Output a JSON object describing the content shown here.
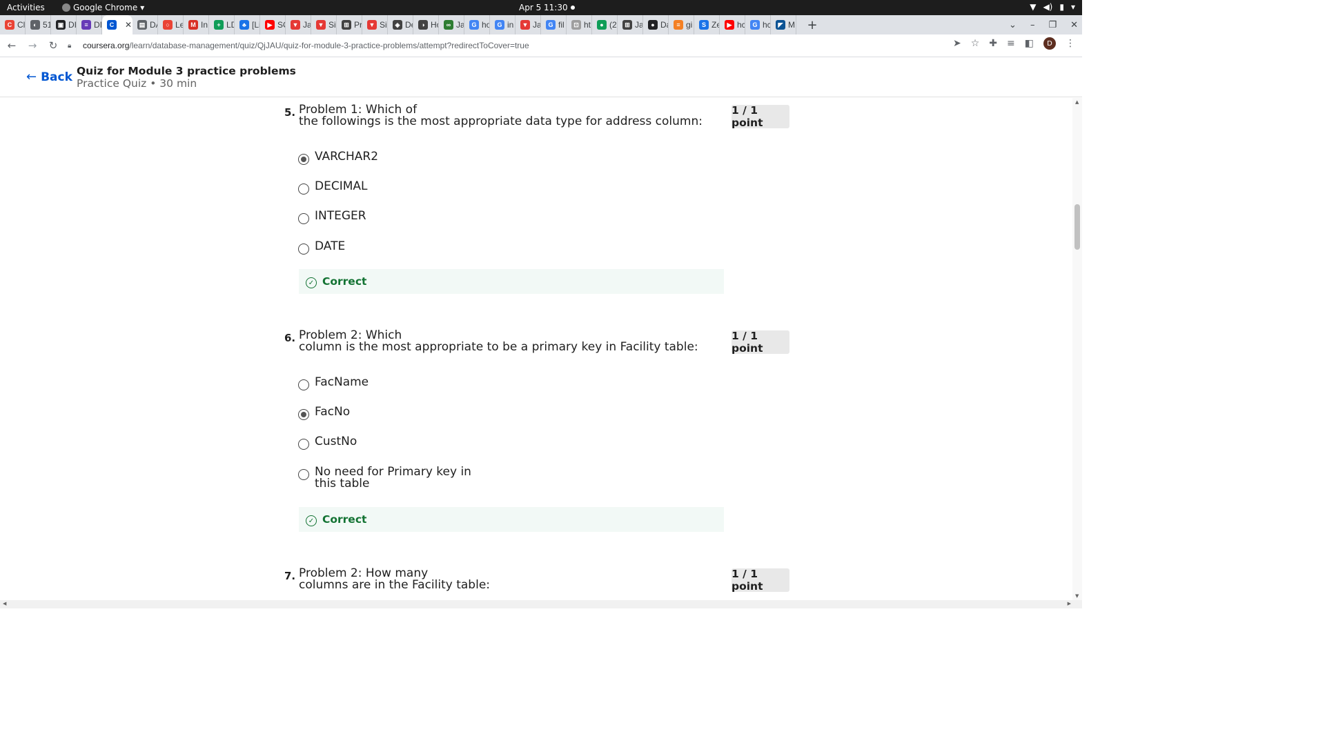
{
  "system": {
    "activities": "Activities",
    "app_name": "Google Chrome",
    "clock": "Apr 5  11:30"
  },
  "tabs": [
    {
      "label": "Cl",
      "color": "#ea4335",
      "glyph": "C"
    },
    {
      "label": "51",
      "color": "#5f6368",
      "glyph": "◐"
    },
    {
      "label": "DI",
      "color": "#202124",
      "glyph": "▣"
    },
    {
      "label": "DI",
      "color": "#673ab7",
      "glyph": "≡"
    },
    {
      "label": "",
      "color": "#0056d2",
      "glyph": "C",
      "active": true
    },
    {
      "label": "DA",
      "color": "#5f6368",
      "glyph": "▤"
    },
    {
      "label": "Le",
      "color": "#ea4335",
      "glyph": "○"
    },
    {
      "label": "In",
      "color": "#d93025",
      "glyph": "M"
    },
    {
      "label": "LD",
      "color": "#0f9d58",
      "glyph": "+"
    },
    {
      "label": "[Li",
      "color": "#1a73e8",
      "glyph": "♣"
    },
    {
      "label": "SC",
      "color": "#ff0000",
      "glyph": "▶"
    },
    {
      "label": "Ja",
      "color": "#e53935",
      "glyph": "▼"
    },
    {
      "label": "Si",
      "color": "#e53935",
      "glyph": "▼"
    },
    {
      "label": "Pr",
      "color": "#424242",
      "glyph": "⊞"
    },
    {
      "label": "Si",
      "color": "#e53935",
      "glyph": "▼"
    },
    {
      "label": "De",
      "color": "#424242",
      "glyph": "◈"
    },
    {
      "label": "Ho",
      "color": "#424242",
      "glyph": "◑"
    },
    {
      "label": "Ja",
      "color": "#2e7d32",
      "glyph": "∞"
    },
    {
      "label": "ho",
      "color": "#4285f4",
      "glyph": "G"
    },
    {
      "label": "in",
      "color": "#4285f4",
      "glyph": "G"
    },
    {
      "label": "Ja",
      "color": "#e53935",
      "glyph": "▼"
    },
    {
      "label": "fil",
      "color": "#4285f4",
      "glyph": "G"
    },
    {
      "label": "ht",
      "color": "#9e9e9e",
      "glyph": "⊡"
    },
    {
      "label": "(2",
      "color": "#0f9d58",
      "glyph": "●"
    },
    {
      "label": "Ja",
      "color": "#424242",
      "glyph": "⊞"
    },
    {
      "label": "Da",
      "color": "#202124",
      "glyph": "●"
    },
    {
      "label": "gi",
      "color": "#f48024",
      "glyph": "≡"
    },
    {
      "label": "Ze",
      "color": "#1a73e8",
      "glyph": "S"
    },
    {
      "label": "hc",
      "color": "#ff0000",
      "glyph": "▶"
    },
    {
      "label": "hc",
      "color": "#4285f4",
      "glyph": "G"
    },
    {
      "label": "M",
      "color": "#0b5394",
      "glyph": "◤"
    }
  ],
  "address": {
    "domain": "coursera.org",
    "path": "/learn/database-management/quiz/QjJAU/quiz-for-module-3-practice-problems/attempt?redirectToCover=true"
  },
  "avatar_initial": "D",
  "header": {
    "back_label": "Back",
    "title": "Quiz for Module 3 practice problems",
    "subtitle": "Practice Quiz • 30 min"
  },
  "questions": [
    {
      "number": "5.",
      "line1": "Problem 1: Which of",
      "line2": "the followings is the most appropriate data type for address column:",
      "points": "1 / 1 point",
      "options": [
        {
          "label": "VARCHAR2",
          "checked": true
        },
        {
          "label": "DECIMAL",
          "checked": false
        },
        {
          "label": "INTEGER",
          "checked": false
        },
        {
          "label": "DATE",
          "checked": false
        }
      ],
      "feedback": "Correct"
    },
    {
      "number": "6.",
      "line1": "Problem 2: Which",
      "line2": "column is the most appropriate to be a primary key in Facility table:",
      "points": "1 / 1 point",
      "options": [
        {
          "label": "FacName",
          "checked": false
        },
        {
          "label": "FacNo",
          "checked": true
        },
        {
          "label": "CustNo",
          "checked": false
        },
        {
          "label": "No need for Primary key in",
          "label2": "this table",
          "checked": false
        }
      ],
      "feedback": "Correct"
    },
    {
      "number": "7.",
      "line1": "Problem 2: How many",
      "line2": "columns are in the Facility table:",
      "points": "1 / 1 point"
    }
  ]
}
